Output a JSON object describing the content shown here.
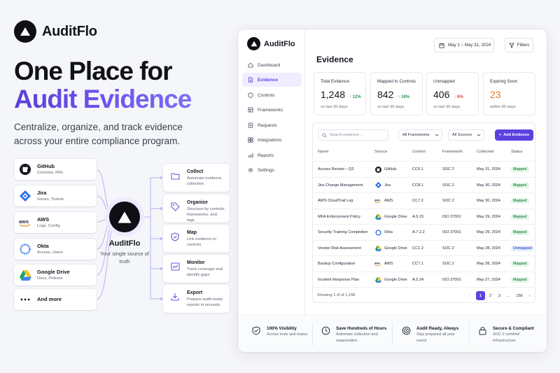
{
  "brand": {
    "name": "AuditFlo"
  },
  "hero": {
    "line1": "One Place for",
    "line2": "Audit Evidence",
    "subtitle": "Centralize, organize, and track evidence across your entire compliance program."
  },
  "sources": [
    {
      "name": "GitHub",
      "desc": "Commits, PRs",
      "icon": "github-icon"
    },
    {
      "name": "Jira",
      "desc": "Issues, Tickets",
      "icon": "jira-icon"
    },
    {
      "name": "AWS",
      "desc": "Logs, Config",
      "icon": "aws-icon"
    },
    {
      "name": "Okta",
      "desc": "Access, Users",
      "icon": "okta-icon"
    },
    {
      "name": "Google Drive",
      "desc": "Docs, Policies",
      "icon": "google-drive-icon"
    },
    {
      "name": "And more",
      "desc": "",
      "icon": "more-icon"
    }
  ],
  "hub": {
    "name": "AuditFlo",
    "tagline": "Your single source of truth"
  },
  "steps": [
    {
      "title": "Collect",
      "desc": "Automate evidence collection",
      "icon": "folder-icon"
    },
    {
      "title": "Organize",
      "desc": "Structure by controls, frameworks, and tags",
      "icon": "tag-icon"
    },
    {
      "title": "Map",
      "desc": "Link evidence to controls",
      "icon": "shield-check-icon"
    },
    {
      "title": "Monitor",
      "desc": "Track coverage and identify gaps",
      "icon": "chart-icon"
    },
    {
      "title": "Export",
      "desc": "Prepare audit-ready reports in seconds",
      "icon": "download-icon"
    }
  ],
  "app": {
    "brand": "AuditFlo",
    "nav": [
      {
        "label": "Dashboard",
        "icon": "home-icon"
      },
      {
        "label": "Evidence",
        "icon": "document-icon",
        "active": true
      },
      {
        "label": "Controls",
        "icon": "shield-icon"
      },
      {
        "label": "Frameworks",
        "icon": "frameworks-icon"
      },
      {
        "label": "Requests",
        "icon": "requests-icon"
      },
      {
        "label": "Integrations",
        "icon": "integrations-icon"
      },
      {
        "label": "Reports",
        "icon": "reports-icon"
      },
      {
        "label": "Settings",
        "icon": "gear-icon"
      }
    ],
    "date_range": "May 1 – May 31, 2024",
    "filters_label": "Filters",
    "page_title": "Evidence",
    "stats": [
      {
        "label": "Total Evidence",
        "value": "1,248",
        "delta": "12%",
        "dir": "up",
        "sub": "vs last 30 days"
      },
      {
        "label": "Mapped to Controls",
        "value": "842",
        "delta": "18%",
        "dir": "up",
        "sub": "vs last 30 days"
      },
      {
        "label": "Unmapped",
        "value": "406",
        "delta": "6%",
        "dir": "down",
        "sub": "vs last 30 days"
      },
      {
        "label": "Expiring Soon",
        "value": "23",
        "delta": "",
        "dir": "",
        "sub": "within 90 days"
      }
    ],
    "search_placeholder": "Search evidence...",
    "filter_frameworks": "All Frameworks",
    "filter_sources": "All Sources",
    "add_label": "Add Evidence",
    "columns": [
      "Name",
      "Source",
      "Control",
      "Framework",
      "Collected",
      "Status"
    ],
    "rows": [
      {
        "name": "Access Review – Q2",
        "source": "GitHub",
        "control": "CC6.1",
        "framework": "SOC 2",
        "collected": "May 31, 2024",
        "status": "Mapped"
      },
      {
        "name": "Jira Change Management",
        "source": "Jira",
        "control": "CC8.1",
        "framework": "SOC 2",
        "collected": "May 30, 2024",
        "status": "Mapped"
      },
      {
        "name": "AWS CloudTrail Log",
        "source": "AWS",
        "control": "CC7.2",
        "framework": "SOC 2",
        "collected": "May 30, 2024",
        "status": "Mapped"
      },
      {
        "name": "MFA Enforcement Policy",
        "source": "Google Drive",
        "control": "A.5.15",
        "framework": "ISO 27001",
        "collected": "May 29, 2024",
        "status": "Mapped"
      },
      {
        "name": "Security Training Completion",
        "source": "Okta",
        "control": "A.7.2.2",
        "framework": "ISO 27001",
        "collected": "May 29, 2024",
        "status": "Mapped"
      },
      {
        "name": "Vendor Risk Assessment",
        "source": "Google Drive",
        "control": "CC1.2",
        "framework": "SOC 2",
        "collected": "May 28, 2024",
        "status": "Unmapped"
      },
      {
        "name": "Backup Configuration",
        "source": "AWS",
        "control": "CC7.1",
        "framework": "SOC 2",
        "collected": "May 28, 2024",
        "status": "Mapped"
      },
      {
        "name": "Incident Response Plan",
        "source": "Google Drive",
        "control": "A.5.24",
        "framework": "ISO 27001",
        "collected": "May 27, 2024",
        "status": "Mapped"
      }
    ],
    "showing": "Showing 1–8 of 1,248",
    "pages": [
      "1",
      "2",
      "3",
      "...",
      "156"
    ],
    "features": [
      {
        "title": "100% Visibility",
        "desc": "Across tools and teams",
        "icon": "shield-check-icon"
      },
      {
        "title": "Save Hundreds of Hours",
        "desc": "Automate collection and organization",
        "icon": "clock-icon"
      },
      {
        "title": "Audit Ready, Always",
        "desc": "Stay prepared all year round",
        "icon": "target-icon"
      },
      {
        "title": "Secure & Compliant",
        "desc": "SOC 2 certified infrastructure",
        "icon": "lock-icon"
      }
    ]
  },
  "colors": {
    "accent": "#5b43e0",
    "mapped": "#2c9650",
    "unmapped": "#4060c8",
    "up": "#2c9650",
    "down": "#d64545",
    "expiring": "#e07b2a"
  }
}
